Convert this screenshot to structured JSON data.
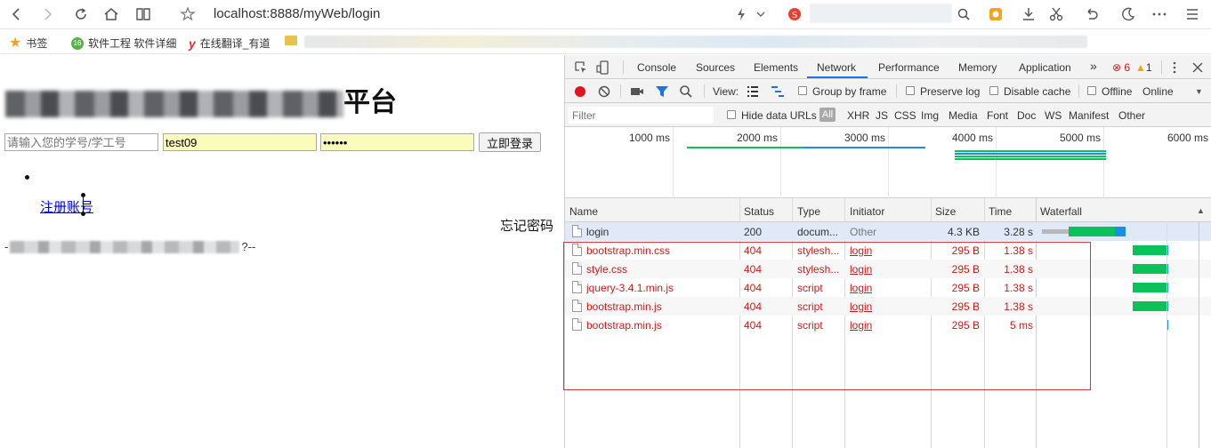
{
  "browser": {
    "address": "localhost:8888/myWeb/login",
    "icons": [
      "back-icon",
      "forward-icon",
      "reload-icon",
      "home-icon",
      "reader-icon",
      "star-icon",
      "lightning-icon",
      "chevron-down-icon",
      "search-engine-icon",
      "search-icon",
      "extension-icon",
      "download-icon",
      "scissors-icon",
      "undo-icon",
      "night-mode-icon",
      "more-icon",
      "menu-icon"
    ]
  },
  "bookmarks": {
    "items": [
      {
        "label": "书签"
      },
      {
        "label": "软件工程 软件详细"
      },
      {
        "label": "在线翻译_有道"
      }
    ]
  },
  "page": {
    "title_visible": "平台",
    "account_placeholder": "请输入您的学号/学工号",
    "username_value": "test09",
    "password_value": "••••••",
    "login_button": "立即登录",
    "register_link": "注册账号",
    "forgot_password": "忘记密码",
    "footer_prefix": "-",
    "footer_suffix": "?--"
  },
  "devtools": {
    "tabs": [
      "Console",
      "Sources",
      "Elements",
      "Network",
      "Performance",
      "Memory",
      "Application"
    ],
    "active_tab": "Network",
    "more_tabs": "»",
    "errors": "6",
    "warnings": "1",
    "toolbar": {
      "view_label": "View:",
      "group_by_frame": "Group by frame",
      "preserve_log": "Preserve log",
      "disable_cache": "Disable cache",
      "offline": "Offline",
      "online": "Online"
    },
    "filter": {
      "placeholder": "Filter",
      "hide_data_urls": "Hide data URLs",
      "all": "All",
      "types": [
        "XHR",
        "JS",
        "CSS",
        "Img",
        "Media",
        "Font",
        "Doc",
        "WS",
        "Manifest",
        "Other"
      ]
    },
    "overview": {
      "ticks": [
        "1000 ms",
        "2000 ms",
        "3000 ms",
        "4000 ms",
        "5000 ms",
        "6000 ms"
      ]
    },
    "columns": [
      "Name",
      "Status",
      "Type",
      "Initiator",
      "Size",
      "Time",
      "Waterfall"
    ],
    "requests": [
      {
        "name": "login",
        "status": "200",
        "type": "docum...",
        "initiator": "Other",
        "size": "4.3 KB",
        "time": "3.28 s",
        "error": false
      },
      {
        "name": "bootstrap.min.css",
        "status": "404",
        "type": "stylesh...",
        "initiator": "login",
        "size": "295 B",
        "time": "1.38 s",
        "error": true
      },
      {
        "name": "style.css",
        "status": "404",
        "type": "stylesh...",
        "initiator": "login",
        "size": "295 B",
        "time": "1.38 s",
        "error": true
      },
      {
        "name": "jquery-3.4.1.min.js",
        "status": "404",
        "type": "script",
        "initiator": "login",
        "size": "295 B",
        "time": "1.38 s",
        "error": true
      },
      {
        "name": "bootstrap.min.js",
        "status": "404",
        "type": "script",
        "initiator": "login",
        "size": "295 B",
        "time": "1.38 s",
        "error": true
      },
      {
        "name": "bootstrap.min.js",
        "status": "404",
        "type": "script",
        "initiator": "login",
        "size": "295 B",
        "time": "5 ms",
        "error": true
      }
    ],
    "colors": {
      "error": "#d11919",
      "waterfall_green": "#0ac15a",
      "waterfall_blue": "#1a8fe8",
      "highlight_box": "#d9373b"
    }
  }
}
